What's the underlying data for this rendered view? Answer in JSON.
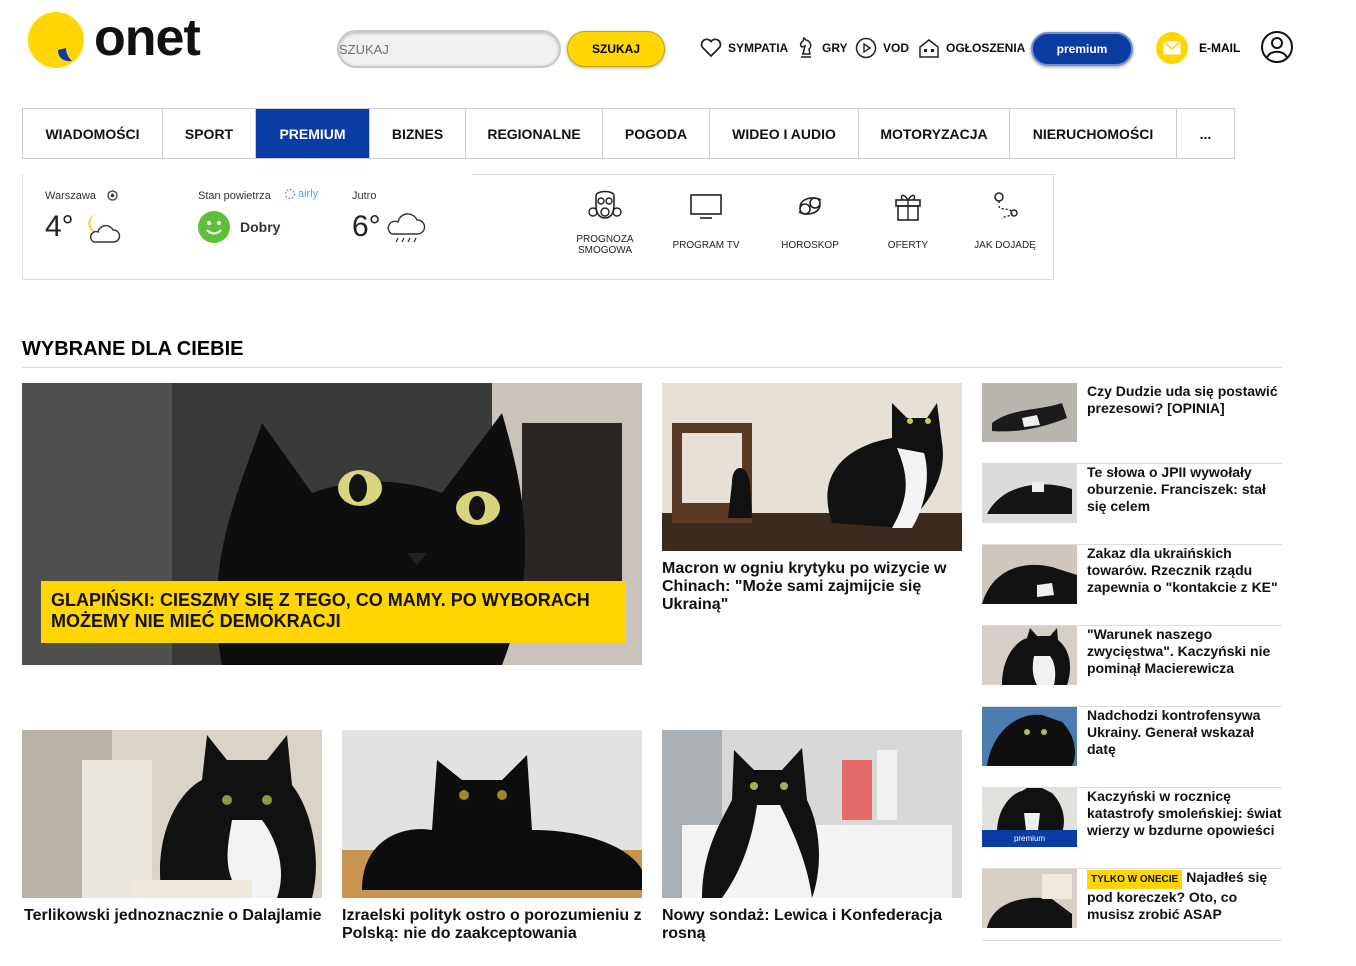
{
  "header": {
    "logo_text": "onet",
    "search_placeholder": "SZUKAJ",
    "search_button": "SZUKAJ",
    "links": [
      {
        "label": "SYMPATIA",
        "icon": "heart-icon"
      },
      {
        "label": "GRY",
        "icon": "chess-knight-icon"
      },
      {
        "label": "VOD",
        "icon": "play-icon"
      },
      {
        "label": "OGŁOSZENIA",
        "icon": "house-icon"
      }
    ],
    "premium": "premium",
    "email": "E-MAIL"
  },
  "nav": [
    {
      "label": "WIADOMOŚCI",
      "active": false
    },
    {
      "label": "SPORT",
      "active": false
    },
    {
      "label": "PREMIUM",
      "active": true
    },
    {
      "label": "BIZNES",
      "active": false
    },
    {
      "label": "REGIONALNE",
      "active": false
    },
    {
      "label": "POGODA",
      "active": false
    },
    {
      "label": "WIDEO I AUDIO",
      "active": false
    },
    {
      "label": "MOTORYZACJA",
      "active": false
    },
    {
      "label": "NIERUCHOMOŚCI",
      "active": false
    },
    {
      "label": "...",
      "active": false
    }
  ],
  "weather": {
    "city": "Warszawa",
    "temp_now": "4°",
    "air_label": "Stan powietrza",
    "air_brand": "airly",
    "air_status": "Dobry",
    "tomorrow_label": "Jutro",
    "temp_tomorrow": "6°"
  },
  "services": [
    {
      "label": "PROGNOZA SMOGOWA",
      "icon": "gas-mask-icon"
    },
    {
      "label": "PROGRAM TV",
      "icon": "tv-icon"
    },
    {
      "label": "HOROSKOP",
      "icon": "cancer-zodiac-icon"
    },
    {
      "label": "OFERTY",
      "icon": "gift-icon"
    },
    {
      "label": "JAK DOJADĘ",
      "icon": "route-icon"
    }
  ],
  "section_title": "WYBRANE DLA CIEBIE",
  "main_article": {
    "title": "GLAPIŃSKI: CIESZMY SIĘ Z TEGO, CO MAMY. PO WYBORACH MOŻEMY NIE MIEĆ DEMOKRACJI"
  },
  "second_article": {
    "title": "Macron w ogniu krytyku po wizycie w Chinach: \"Może sami zajmijcie się Ukrainą\""
  },
  "bottom_articles": [
    {
      "title": "Terlikowski jednoznacznie o Dalajlamie"
    },
    {
      "title": "Izraelski polityk ostro o porozumieniu z Polską: nie do zaakceptowania"
    },
    {
      "title": "Nowy sondaż: Lewica i Konfederacja rosną"
    }
  ],
  "side_articles": [
    {
      "title": "Czy Dudzie uda się postawić prezesowi? [OPINIA]"
    },
    {
      "title": "Te słowa o JPII wywołały oburzenie. Franciszek: stał się celem"
    },
    {
      "title": "Zakaz dla ukraińskich towarów. Rzecznik rządu zapewnia o \"kontakcie z KE\""
    },
    {
      "title": "\"Warunek naszego zwycięstwa\". Kaczyński nie pominął Macierewicza"
    },
    {
      "title": "Nadchodzi kontrofensywa Ukrainy. Generał wskazał datę"
    },
    {
      "title": "Kaczyński w rocznicę katastrofy smoleńskiej: świat wierzy w bzdurne opowieści",
      "thumb_badge": "premium"
    },
    {
      "title": "Najadłeś się pod koreczek? Oto, co musisz zrobić ASAP",
      "badge": "TYLKO W ONECIE"
    }
  ],
  "colors": {
    "brand_yellow": "#ffd600",
    "premium_blue": "#0a3ca5",
    "air_good": "#5fbf3a"
  }
}
